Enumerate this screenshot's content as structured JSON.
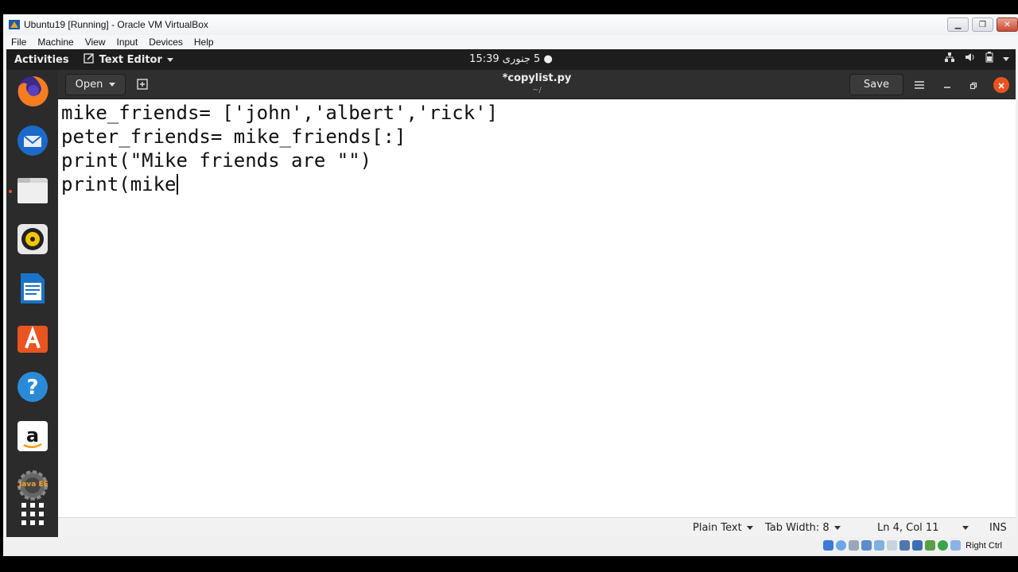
{
  "vbox": {
    "title": "Ubuntu19 [Running] - Oracle VM VirtualBox",
    "menu": [
      "File",
      "Machine",
      "View",
      "Input",
      "Devices",
      "Help"
    ],
    "host_key": "Right Ctrl"
  },
  "topbar": {
    "activities": "Activities",
    "app_name": "Text Editor",
    "clock_time": "15:39",
    "clock_date": "5 جنوری"
  },
  "dock": {
    "items": [
      "firefox-icon",
      "thunderbird-icon",
      "files-icon",
      "rhythmbox-icon",
      "libreoffice-writer-icon",
      "software-center-icon",
      "help-icon",
      "amazon-icon",
      "java-ee-icon",
      "show-apps-icon"
    ],
    "java_label": "Java EE"
  },
  "gedit": {
    "open_label": "Open",
    "doc_title": "*copylist.py",
    "doc_path": "~/",
    "save_label": "Save",
    "lines": [
      "mike_friends= ['john','albert','rick']",
      "peter_friends= mike_friends[:]",
      "print(\"Mike friends are \"\")",
      "print(mike"
    ],
    "status": {
      "language": "Plain Text",
      "tab_width": "Tab Width: 8",
      "position": "Ln 4, Col 11",
      "mode": "INS"
    }
  },
  "colors": {
    "accent": "#e95420",
    "topbar": "#1d1d1d",
    "headerbar": "#2f2f2f"
  }
}
